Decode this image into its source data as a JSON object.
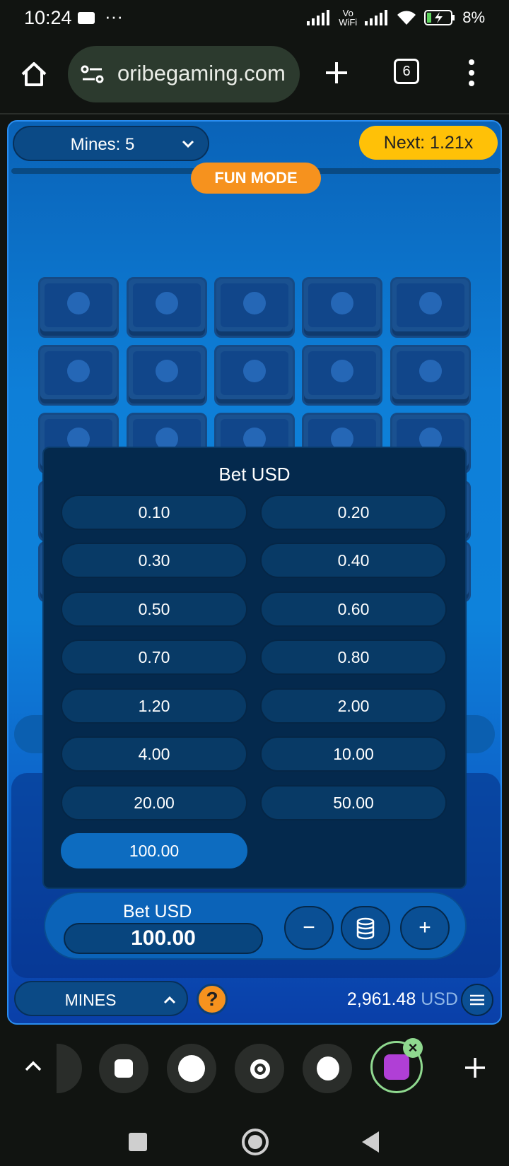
{
  "status_bar": {
    "time": "10:24",
    "dots": "···",
    "network": "Vo WiFi",
    "battery": "8%"
  },
  "browser": {
    "url": "oribegaming.com",
    "tab_count": "6"
  },
  "game": {
    "mines_select": {
      "label": "Mines: 5"
    },
    "next_badge": {
      "label": "Next: 1.21x"
    },
    "fun_mode": "FUN MODE",
    "bet_panel": {
      "title": "Bet USD",
      "options": [
        "0.10",
        "0.20",
        "0.30",
        "0.40",
        "0.50",
        "0.60",
        "0.70",
        "0.80",
        "1.20",
        "2.00",
        "4.00",
        "10.00",
        "20.00",
        "50.00",
        "100.00"
      ],
      "selected": "100.00"
    },
    "bet_control": {
      "label": "Bet USD",
      "value": "100.00",
      "minus": "−",
      "plus": "+"
    },
    "game_select": {
      "label": "MINES"
    },
    "help": "?",
    "balance": {
      "amount": "2,961.48",
      "currency": "USD"
    }
  },
  "colors": {
    "accent_yellow": "#ffc107",
    "fun_mode_orange": "#f6921e",
    "game_blue": "#0e7fd8",
    "panel_navy": "#04294d"
  }
}
